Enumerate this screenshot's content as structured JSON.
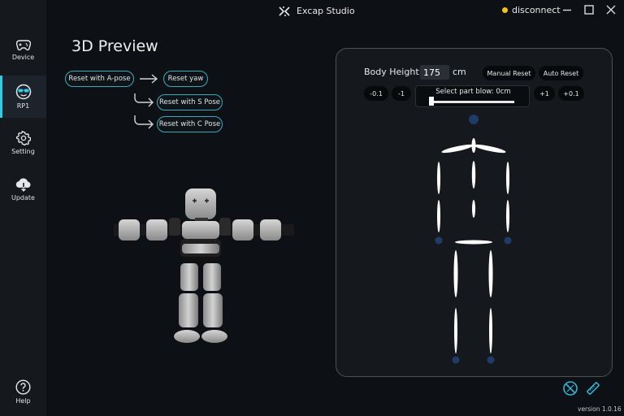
{
  "app": {
    "title": "Excap Studio",
    "connection_status": "disconnect",
    "status_color": "#f2c418",
    "accent_color": "#2bd0e6",
    "version": "version 1.0.16"
  },
  "sidebar": {
    "items": [
      {
        "label": "Device",
        "icon": "gamepad-icon"
      },
      {
        "label": "RP1",
        "icon": "sunglasses-face-icon",
        "active": true
      },
      {
        "label": "Setting",
        "icon": "gear-icon"
      },
      {
        "label": "Update",
        "icon": "cloud-download-icon"
      }
    ],
    "help_label": "Help"
  },
  "preview": {
    "title": "3D Preview",
    "buttons": {
      "reset_a_pose": "Reset with A-pose",
      "reset_yaw": "Reset yaw",
      "reset_s_pose": "Reset with S Pose",
      "reset_c_pose": "Reset with C Pose"
    }
  },
  "calibration": {
    "body_height_label": "Body Height:",
    "body_height_value": "175",
    "unit": "cm",
    "manual_reset": "Manual Reset",
    "auto_reset": "Auto Reset",
    "minus_01": "-0.1",
    "minus_1": "-1",
    "plus_1": "+1",
    "plus_01": "+0.1",
    "part_label": "Select part blow: 0cm",
    "part_value": 0
  }
}
